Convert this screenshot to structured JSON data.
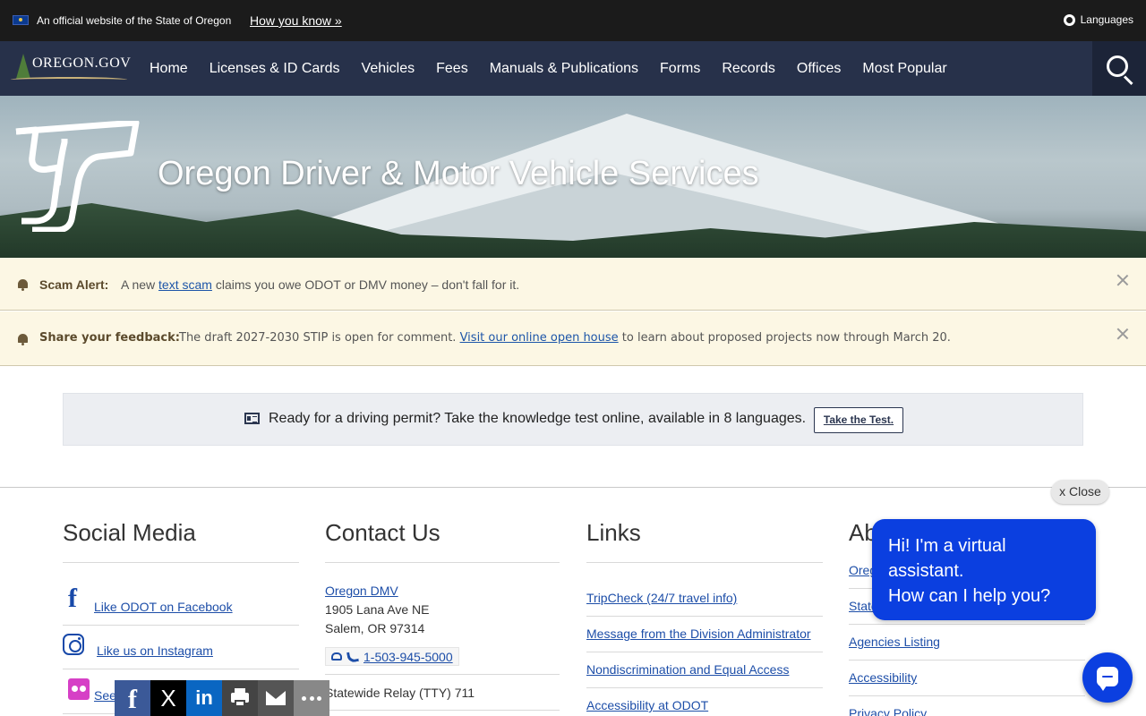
{
  "topbar": {
    "official": "An official website of the State of Oregon",
    "how_you_know": "How you know »",
    "languages": "Languages"
  },
  "nav": {
    "logo_text": "OREGON.GOV",
    "items": [
      "Home",
      "Licenses & ID Cards",
      "Vehicles",
      "Fees",
      "Manuals & Publications",
      "Forms",
      "Records",
      "Offices",
      "Most Popular"
    ]
  },
  "hero": {
    "title": "Oregon Driver & Motor Vehicle Services"
  },
  "alerts": {
    "scam": {
      "label": "Scam Alert:",
      "text_before": "A new ",
      "link": "text scam",
      "text_after": " claims you owe ODOT or DMV money – don't fall for it."
    },
    "feedback": {
      "label": "Share your feedback:",
      "text_before": "The draft 2027-2030 STIP is open for comment. ",
      "link": "Visit our online open house",
      "text_after": " to learn about  proposed projects now through March 20."
    }
  },
  "permit": {
    "text": "Ready for a driving permit? Take the knowledge test online, available in 8 languages.",
    "button": "Take the Test."
  },
  "footer": {
    "social": {
      "heading": "Social Media",
      "facebook": "Like ODOT on Facebook",
      "instagram": "Like us on Instagram",
      "flickr": "See"
    },
    "contact": {
      "heading": "Contact Us",
      "org": "Oregon DMV",
      "street": "1905 Lana Ave NE",
      "city": "Salem, OR 97314",
      "phone": "1-503-945-5000",
      "relay": "Statewide Relay (TTY) 711"
    },
    "links": {
      "heading": "Links",
      "items": [
        "TripCheck (24/7 travel info)",
        "Message from the Division Administrator",
        "Nondiscrimination and Equal Access",
        "Accessibility at ODOT"
      ]
    },
    "about": {
      "heading": "Ab",
      "items": [
        "Oreg",
        "State",
        "Agencies Listing",
        "Accessibility",
        "Privacy Policy"
      ]
    }
  },
  "chat": {
    "close": "x Close",
    "line1": "Hi! I'm a virtual",
    "line2": "assistant.",
    "line3": "How can I help you?"
  },
  "share": {
    "facebook": "f",
    "x": "X",
    "linkedin": "in"
  }
}
